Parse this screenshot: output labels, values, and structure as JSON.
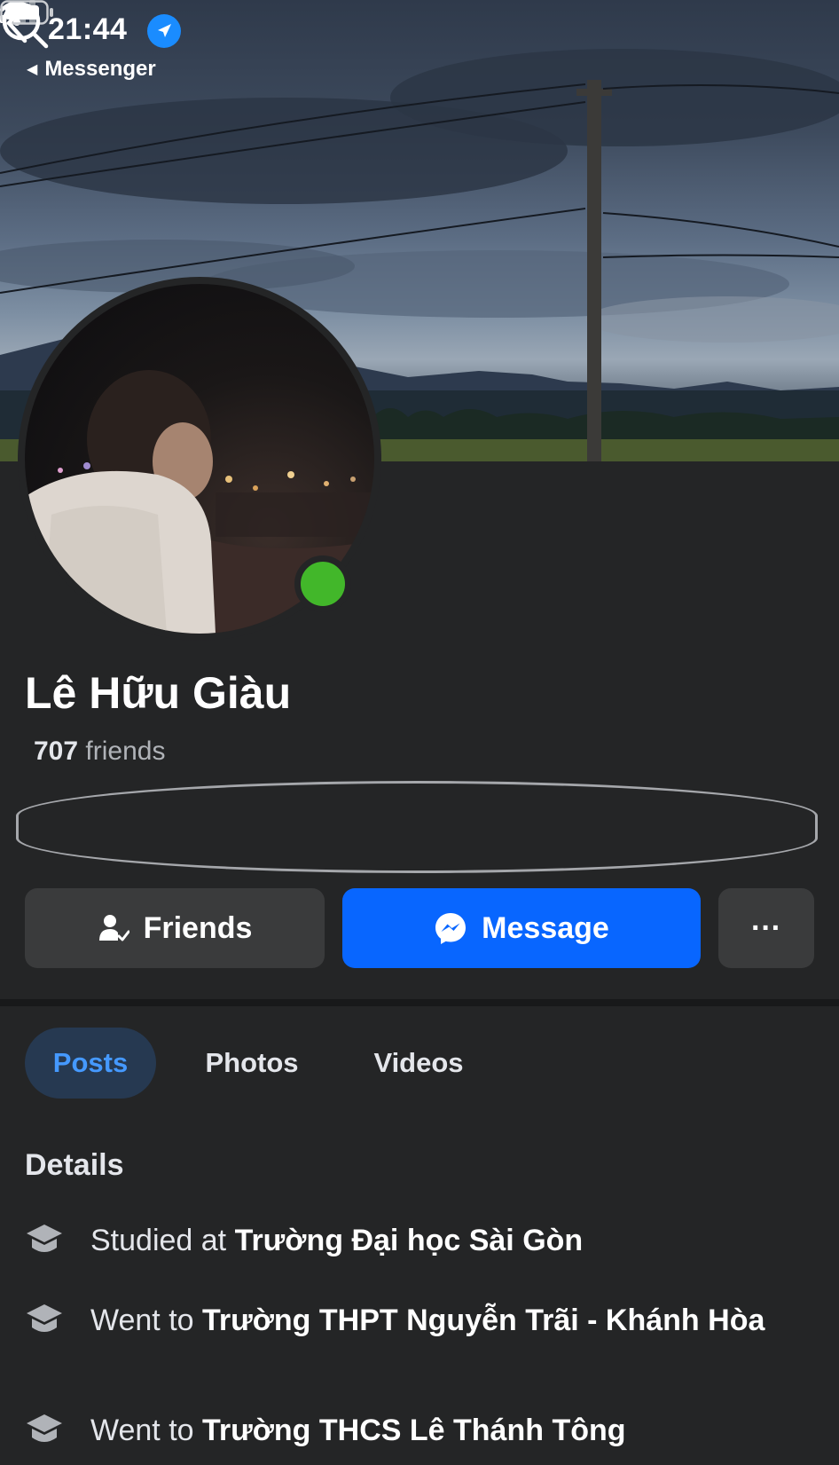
{
  "status_bar": {
    "time": "21:44",
    "back_app": "Messenger"
  },
  "profile": {
    "name": "Lê Hữu Giàu",
    "friends_count": "707",
    "friends_label": "friends"
  },
  "actions": {
    "friends_label": "Friends",
    "message_label": "Message",
    "more_label": "···"
  },
  "tabs": [
    {
      "label": "Posts",
      "active": true
    },
    {
      "label": "Photos",
      "active": false
    },
    {
      "label": "Videos",
      "active": false
    }
  ],
  "details": {
    "title": "Details",
    "items": [
      {
        "prefix": "Studied at ",
        "place": "Trường Đại học Sài Gòn"
      },
      {
        "prefix": "Went to ",
        "place": "Trường THPT Nguyễn Trãi - Khánh Hòa"
      },
      {
        "prefix": "Went to ",
        "place": "Trường THCS Lê Thánh Tông"
      }
    ]
  },
  "colors": {
    "background": "#242526",
    "primary_button": "#0866ff",
    "secondary_button": "#3a3b3c",
    "active_tab_bg": "#263951",
    "active_tab_text": "#4599ff",
    "online": "#42b72a"
  },
  "icons": [
    "location-arrow-icon",
    "signal-icon",
    "wifi-icon",
    "battery-icon",
    "back-arrow-icon",
    "search-icon",
    "friends-check-icon",
    "messenger-icon",
    "education-icon"
  ]
}
